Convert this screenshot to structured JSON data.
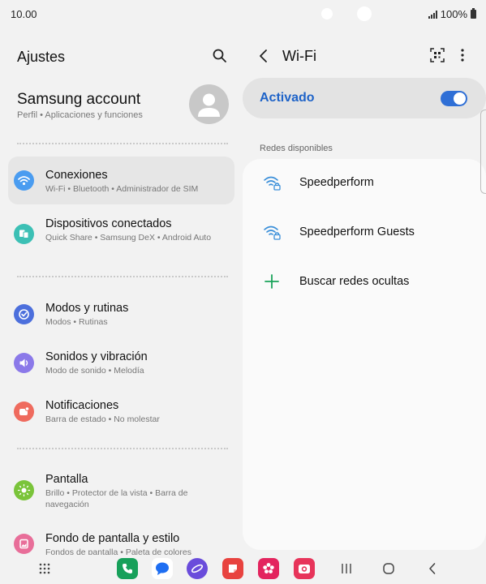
{
  "status_bar": {
    "time": "10.00",
    "battery": "100%"
  },
  "left": {
    "title": "Ajustes",
    "account": {
      "name": "Samsung account",
      "sub": "Perfil  •  Aplicaciones y funciones"
    },
    "items": [
      {
        "label": "Conexiones",
        "desc": "Wi-Fi  •  Bluetooth  •  Administrador de SIM",
        "icon": "wifi-icon",
        "color": "#4a9cf0"
      },
      {
        "label": "Dispositivos conectados",
        "desc": "Quick Share  •  Samsung DeX  •  Android Auto",
        "icon": "devices-icon",
        "color": "#3cc0b5"
      },
      {
        "label": "Modos y rutinas",
        "desc": "Modos  •  Rutinas",
        "icon": "check-circle-icon",
        "color": "#4c6fdc"
      },
      {
        "label": "Sonidos y vibración",
        "desc": "Modo de sonido  •  Melodía",
        "icon": "speaker-icon",
        "color": "#8b79e9"
      },
      {
        "label": "Notificaciones",
        "desc": "Barra de estado  •  No molestar",
        "icon": "notification-icon",
        "color": "#ef6b5e"
      },
      {
        "label": "Pantalla",
        "desc": "Brillo  •  Protector de la vista  •  Barra de navegación",
        "icon": "sun-icon",
        "color": "#7ac43a"
      },
      {
        "label": "Fondo de pantalla y estilo",
        "desc": "Fondos de pantalla  •  Paleta de colores",
        "icon": "wallpaper-icon",
        "color": "#e86e99"
      }
    ]
  },
  "wifi": {
    "title": "Wi-Fi",
    "toggle_label": "Activado",
    "toggle_on": true,
    "section_label": "Redes disponibles",
    "networks": [
      {
        "name": "Speedperform",
        "icon": "wifi-lock-icon"
      },
      {
        "name": "Speedperform Guests",
        "icon": "wifi-lock-icon"
      }
    ],
    "add_hidden": "Buscar redes ocultas"
  },
  "dock": [
    {
      "name": "phone-app-icon",
      "color": "#17a05a"
    },
    {
      "name": "messages-app-icon",
      "color": "#1e6ef2"
    },
    {
      "name": "internet-app-icon",
      "color": "#6a4cdb"
    },
    {
      "name": "notes-app-icon",
      "color": "#e8433f"
    },
    {
      "name": "gallery-app-icon",
      "color": "#e3245e"
    },
    {
      "name": "camera-app-icon",
      "color": "#e7345a"
    }
  ]
}
